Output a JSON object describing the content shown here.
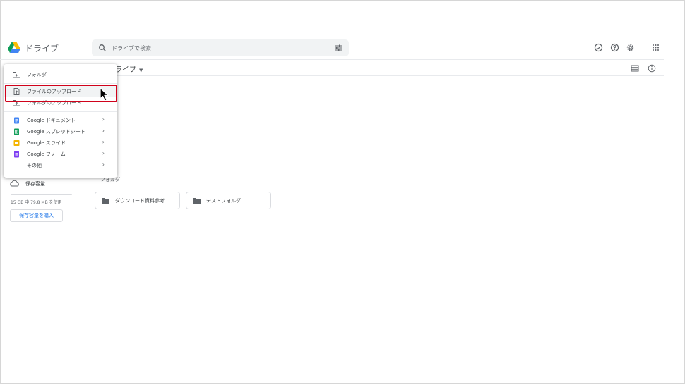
{
  "app": {
    "title": "ドライブ"
  },
  "search": {
    "placeholder": "ドライブで検索"
  },
  "header_icons": [
    "offline-status-icon",
    "help-icon",
    "settings-icon",
    "apps-grid-icon"
  ],
  "breadcrumb": {
    "label": "ライブ"
  },
  "menu": {
    "items": [
      {
        "label": "フォルダ",
        "icon": "new-folder-icon"
      },
      {
        "label": "ファイルのアップロード",
        "icon": "file-upload-icon"
      },
      {
        "label": "フォルダのアップロード",
        "icon": "folder-upload-icon"
      },
      {
        "label": "Google ドキュメント",
        "icon": "docs-icon",
        "color": "#4285f4"
      },
      {
        "label": "Google スプレッドシート",
        "icon": "sheets-icon",
        "color": "#0f9d58"
      },
      {
        "label": "Google スライド",
        "icon": "slides-icon",
        "color": "#f4b400"
      },
      {
        "label": "Google フォーム",
        "icon": "forms-icon",
        "color": "#7e3ff2"
      },
      {
        "label": "その他"
      }
    ],
    "chevron": "›"
  },
  "storage": {
    "label": "保存容量",
    "used_text": "15 GB 中 79.8 MB を使用",
    "used_fraction": 0.005,
    "buy_label": "保存容量を購入"
  },
  "folders": {
    "section_label": "フォルダ",
    "items": [
      {
        "name": "ダウンロード資料参考"
      },
      {
        "name": "テストフォルダ"
      }
    ]
  },
  "colors": {
    "accent": "#1a73e8",
    "highlight": "#d0021b"
  }
}
